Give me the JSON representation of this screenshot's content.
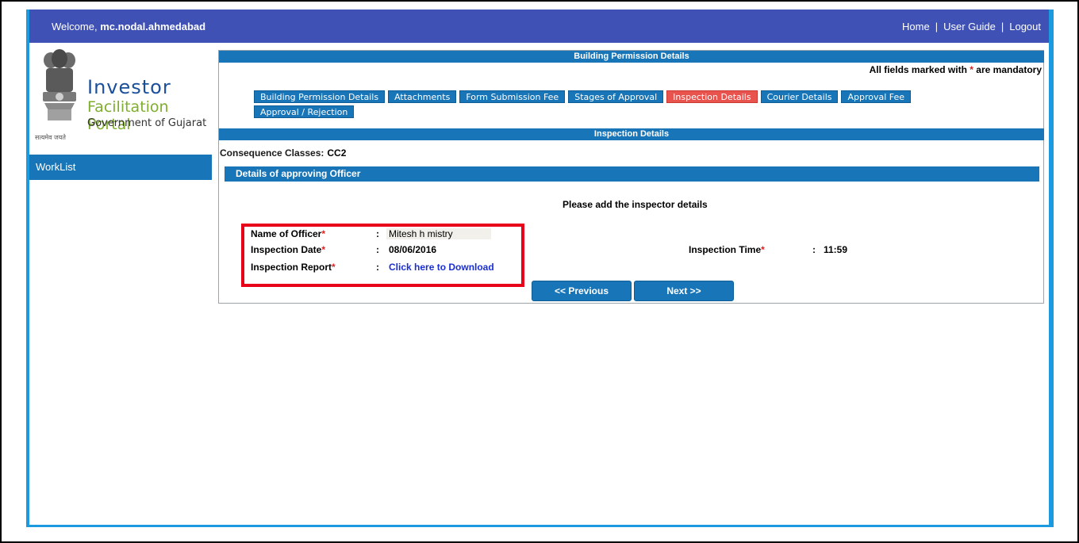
{
  "header": {
    "welcome_label": "Welcome,",
    "username": "mc.nodal.ahmedabad",
    "nav": {
      "home": "Home",
      "user_guide": "User Guide",
      "logout": "Logout",
      "separator": "|"
    }
  },
  "logo": {
    "line1": "Investor",
    "line2": "Facilitation Portal",
    "line3": "Government of Gujarat",
    "motto": "सत्यमेव जयते"
  },
  "sidebar": {
    "worklist": "WorkList"
  },
  "main": {
    "title": "Building Permission Details",
    "mandatory_prefix": "All fields marked with",
    "mandatory_star": "*",
    "mandatory_suffix": "are mandatory",
    "tabs": [
      {
        "label": "Building Permission Details",
        "active": false
      },
      {
        "label": "Attachments",
        "active": false
      },
      {
        "label": "Form Submission Fee",
        "active": false
      },
      {
        "label": "Stages of Approval",
        "active": false
      },
      {
        "label": "Inspection Details",
        "active": true
      },
      {
        "label": "Courier Details",
        "active": false
      },
      {
        "label": "Approval Fee",
        "active": false
      },
      {
        "label": "Approval / Rejection",
        "active": false
      }
    ],
    "section_title": "Inspection Details",
    "consequence_label": "Consequence Classes:",
    "consequence_value": "CC2",
    "officer_section_title": "Details of approving Officer",
    "info_text": "Please add the inspector details",
    "fields": {
      "officer_name_label": "Name of Officer",
      "officer_name_value": "Mitesh h mistry",
      "inspection_date_label": "Inspection Date",
      "inspection_date_value": "08/06/2016",
      "inspection_report_label": "Inspection Report",
      "inspection_report_value": "Click here to Download",
      "inspection_time_label": "Inspection Time",
      "inspection_time_value": "11:59",
      "required_star": "*",
      "colon": ":"
    },
    "buttons": {
      "previous": "<< Previous",
      "next": "Next >>"
    }
  },
  "colors": {
    "header": "#3f51b5",
    "primary": "#1875b8",
    "active_tab": "#e8534e",
    "highlight": "#e8001a"
  }
}
